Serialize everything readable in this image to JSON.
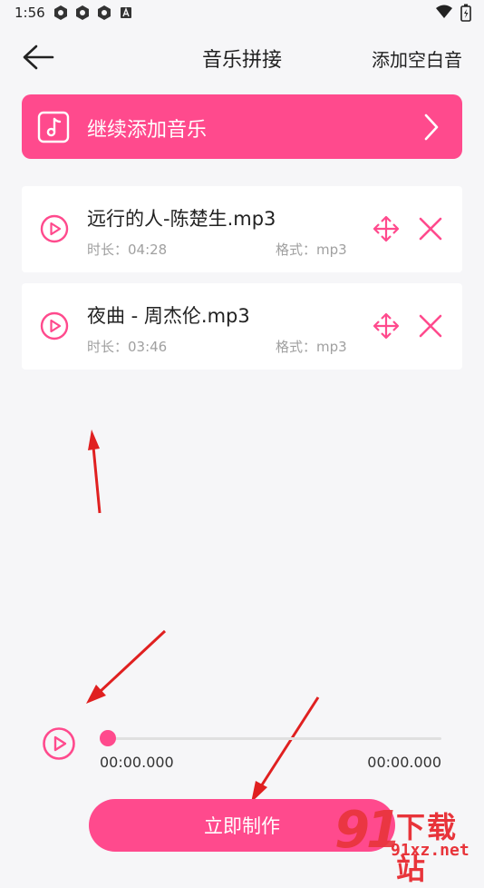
{
  "status_bar": {
    "time": "1:56"
  },
  "header": {
    "title": "音乐拼接",
    "add_silence": "添加空白音"
  },
  "add_music": {
    "label": "继续添加音乐"
  },
  "tracks": [
    {
      "name": "远行的人-陈楚生.mp3",
      "duration": "时长：04:28",
      "format": "格式：mp3"
    },
    {
      "name": "夜曲 - 周杰伦.mp3",
      "duration": "时长：03:46",
      "format": "格式：mp3"
    }
  ],
  "player": {
    "current_time": "00:00.000",
    "total_time": "00:00.000",
    "progress": 0
  },
  "make_button": {
    "label": "立即制作"
  },
  "watermark": {
    "digits": "91",
    "name": "下载站",
    "url": "91xz.net"
  },
  "colors": {
    "accent": "#ff4a8d",
    "background": "#f6f6f8",
    "annotation_arrow": "#e02020"
  }
}
